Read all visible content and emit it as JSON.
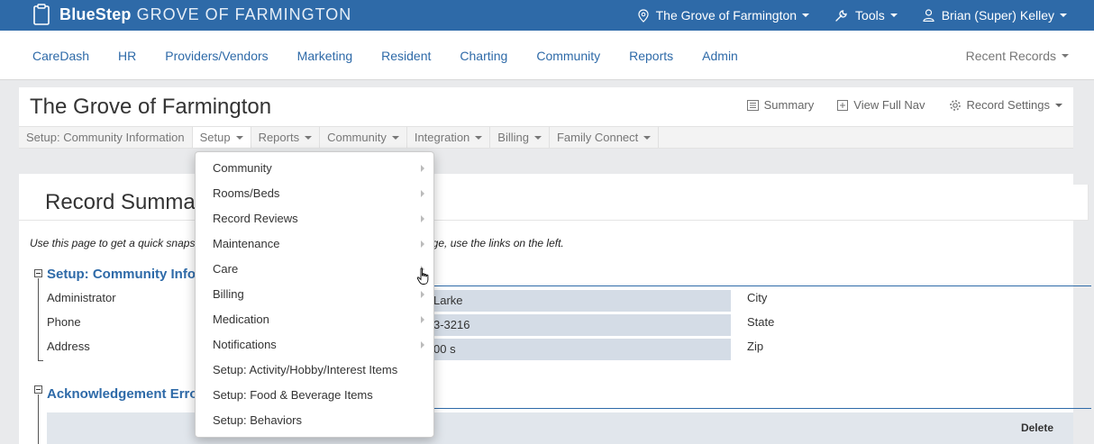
{
  "topbar": {
    "brand": "BlueStep",
    "brand_sub": "GROVE OF FARMINGTON",
    "location": "The Grove of Farmington",
    "tools": "Tools",
    "user": "Brian (Super) Kelley",
    "bg_color": "#2e6aa8"
  },
  "mainnav": {
    "items": [
      "CareDash",
      "HR",
      "Providers/Vendors",
      "Marketing",
      "Resident",
      "Charting",
      "Community",
      "Reports",
      "Admin"
    ],
    "recent": "Recent Records"
  },
  "record": {
    "title": "The Grove of Farmington",
    "actions": {
      "summary": "Summary",
      "view_full_nav": "View Full Nav",
      "record_settings": "Record Settings"
    },
    "subnav": [
      "Setup: Community Information",
      "Setup",
      "Reports",
      "Community",
      "Integration",
      "Billing",
      "Family Connect"
    ]
  },
  "content": {
    "summary_title": "Record Summary",
    "intro_left": "Use this page to get a quick snapsh",
    "intro_right": "age, use the links on the left.",
    "section1": {
      "title": "Setup: Community Info",
      "labels": [
        "Administrator",
        "Phone",
        "Address"
      ],
      "values": [
        "Larke",
        "3-3216",
        "00 s"
      ],
      "right_labels": [
        "City",
        "State",
        "Zip"
      ]
    },
    "section2": {
      "title": "Acknowledgement Erro",
      "delete_header": "Delete"
    }
  },
  "dropdown": {
    "items": [
      {
        "label": "Community",
        "submenu": true
      },
      {
        "label": "Rooms/Beds",
        "submenu": true
      },
      {
        "label": "Record Reviews",
        "submenu": true
      },
      {
        "label": "Maintenance",
        "submenu": true
      },
      {
        "label": "Care",
        "submenu": true
      },
      {
        "label": "Billing",
        "submenu": true
      },
      {
        "label": "Medication",
        "submenu": true
      },
      {
        "label": "Notifications",
        "submenu": true
      },
      {
        "label": "Setup: Activity/Hobby/Interest Items",
        "submenu": false
      },
      {
        "label": "Setup: Food & Beverage Items",
        "submenu": false
      },
      {
        "label": "Setup: Behaviors",
        "submenu": false
      }
    ]
  }
}
